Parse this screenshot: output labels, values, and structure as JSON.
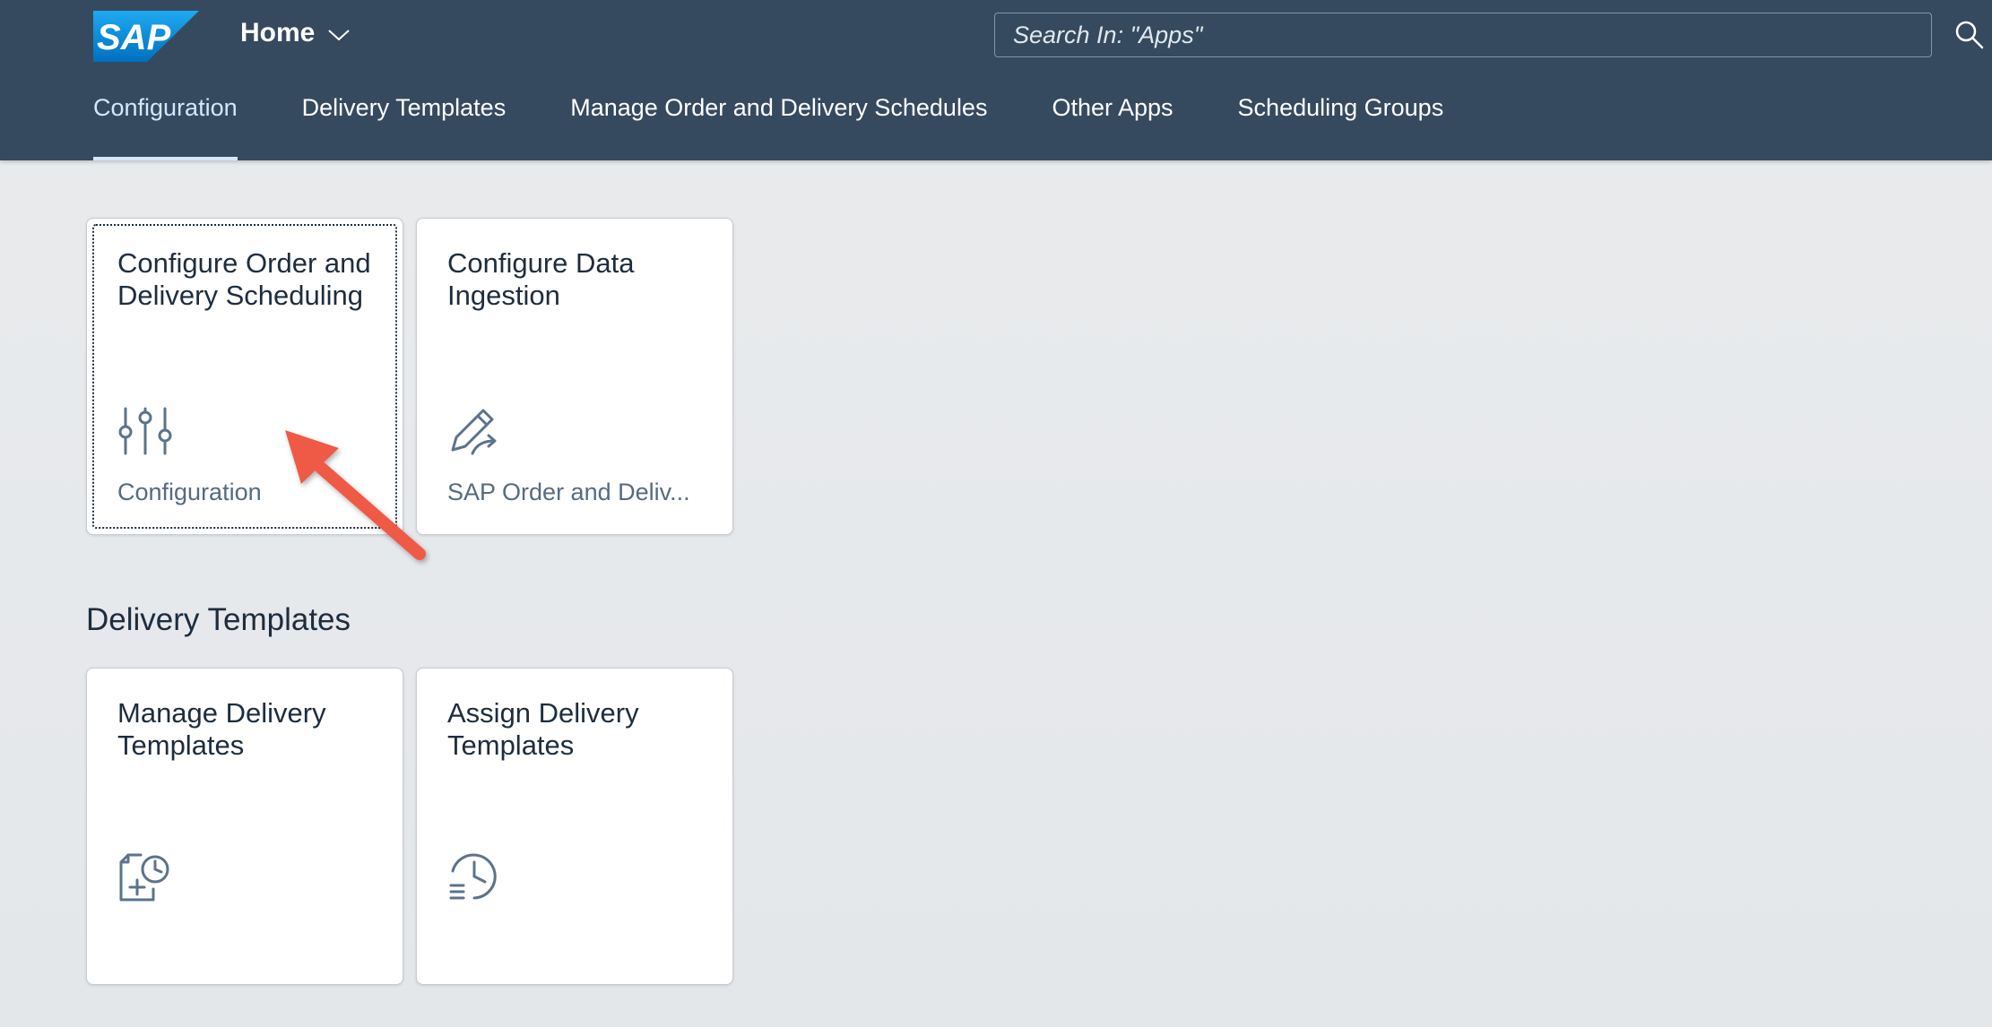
{
  "header": {
    "logo_text": "SAP",
    "home_title": "Home",
    "search_placeholder": "Search In: \"Apps\"",
    "background_color": "#354a5f"
  },
  "tabs": [
    {
      "label": "Configuration",
      "selected": true
    },
    {
      "label": "Delivery Templates",
      "selected": false
    },
    {
      "label": "Manage Order and Delivery Schedules",
      "selected": false
    },
    {
      "label": "Other Apps",
      "selected": false
    },
    {
      "label": "Scheduling Groups",
      "selected": false
    }
  ],
  "configuration_tiles": [
    {
      "title": "Configure Order and Delivery Scheduling",
      "subtitle": "Configuration",
      "icon": "sliders-icon",
      "focused": true
    },
    {
      "title": "Configure Data Ingestion",
      "subtitle": "SAP Order and Deliv...",
      "icon": "edit-share-icon",
      "focused": false
    }
  ],
  "delivery_templates_section": {
    "title": "Delivery Templates",
    "tiles": [
      {
        "title": "Manage Delivery Templates",
        "subtitle": "",
        "icon": "document-add-clock-icon"
      },
      {
        "title": "Assign Delivery Templates",
        "subtitle": "",
        "icon": "history-list-icon"
      }
    ]
  },
  "annotation": {
    "type": "arrow",
    "color": "#ef5a47"
  }
}
